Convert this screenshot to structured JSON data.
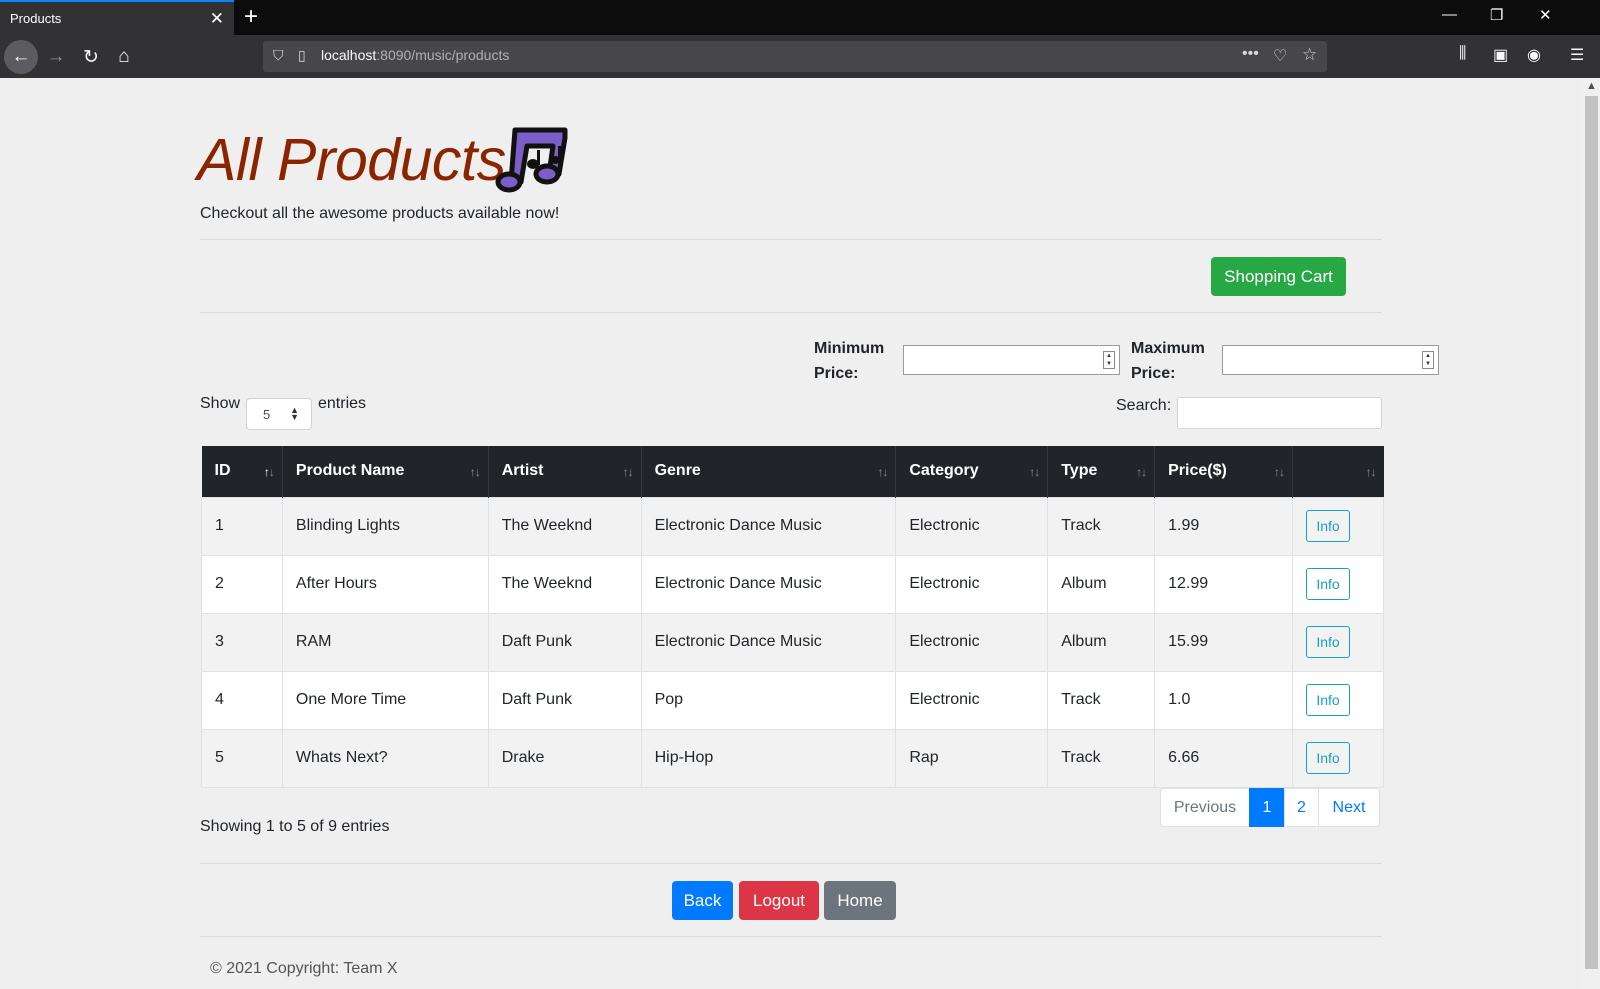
{
  "browser": {
    "tab_title": "Products",
    "url_host": "localhost",
    "url_rest": ":8090/music/products"
  },
  "page": {
    "title": "All Products",
    "subtitle": "Checkout all the awesome products available now!",
    "shopping_cart_label": "Shopping Cart",
    "min_price_label_1": "Minimum",
    "min_price_label_2": "Price:",
    "max_price_label_1": "Maximum",
    "max_price_label_2": "Price:",
    "show_label": "Show",
    "entries_label": "entries",
    "entries_selected": "5",
    "search_label": "Search:"
  },
  "table": {
    "headers": [
      "ID",
      "Product Name",
      "Artist",
      "Genre",
      "Category",
      "Type",
      "Price($)",
      ""
    ],
    "info_label": "Info",
    "rows": [
      [
        "1",
        "Blinding Lights",
        "The Weeknd",
        "Electronic Dance Music",
        "Electronic",
        "Track",
        "1.99"
      ],
      [
        "2",
        "After Hours",
        "The Weeknd",
        "Electronic Dance Music",
        "Electronic",
        "Album",
        "12.99"
      ],
      [
        "3",
        "RAM",
        "Daft Punk",
        "Electronic Dance Music",
        "Electronic",
        "Album",
        "15.99"
      ],
      [
        "4",
        "One More Time",
        "Daft Punk",
        "Pop",
        "Electronic",
        "Track",
        "1.0"
      ],
      [
        "5",
        "Whats Next?",
        "Drake",
        "Hip-Hop",
        "Rap",
        "Track",
        "6.66"
      ]
    ]
  },
  "pagination": {
    "showing_text": "Showing 1 to 5 of 9 entries",
    "previous": "Previous",
    "page1": "1",
    "page2": "2",
    "next": "Next"
  },
  "actions": {
    "back": "Back",
    "logout": "Logout",
    "home": "Home"
  },
  "footer": {
    "copyright": "© 2021 Copyright: Team X"
  },
  "colors": {
    "title": "#8b2500",
    "green": "#28a745",
    "blue": "#007bff",
    "red": "#dc3545",
    "grey": "#6c757d",
    "info": "#17a2b8",
    "table_header": "#212529"
  }
}
